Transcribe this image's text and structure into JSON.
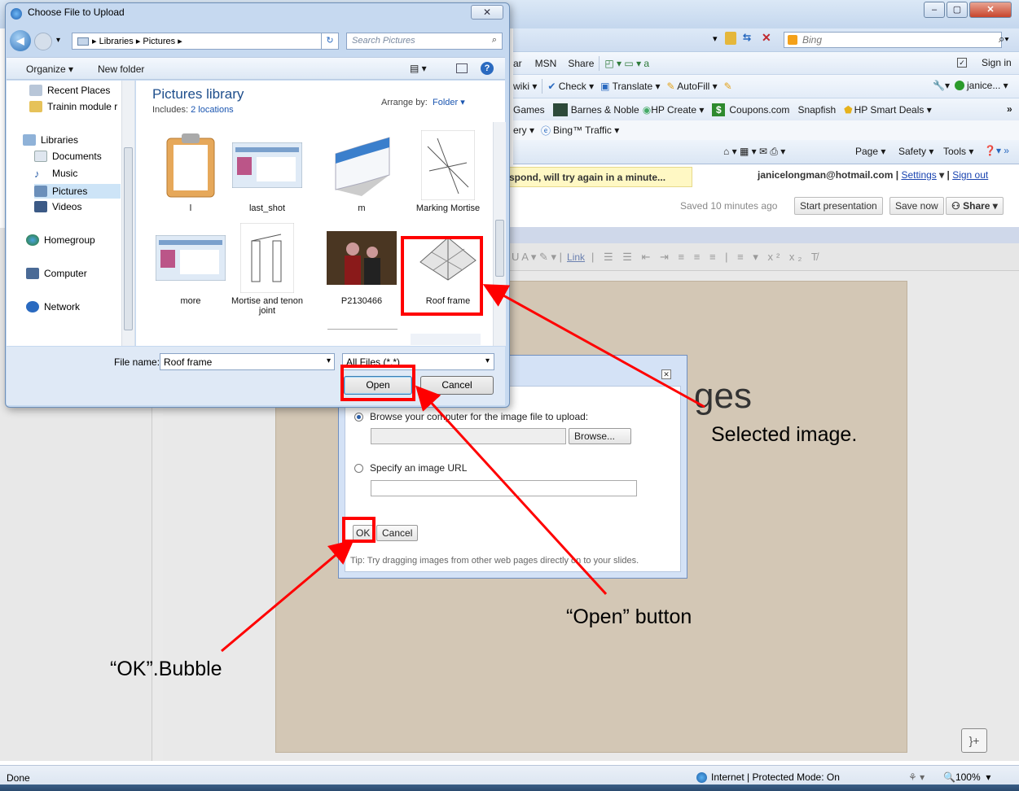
{
  "ie": {
    "bing_placeholder": "Bing",
    "cmd_row1": [
      "ar",
      "MSN",
      "Share"
    ],
    "sign_in": "Sign in",
    "cmd_row2": [
      "wiki ▾",
      "Check ▾",
      "Translate ▾",
      "AutoFill ▾"
    ],
    "user_short": "janice... ▾",
    "favorites": [
      "Games",
      "Barnes & Noble",
      "HP Create",
      "Coupons.com",
      "Snapfish",
      "HP Smart Deals ▾"
    ],
    "tab_items": [
      "ery ▾",
      "Bing™ Traffic ▾"
    ],
    "cmd_row3": [
      "Page ▾",
      "Safety ▾",
      "Tools ▾"
    ],
    "status_done": "Done",
    "status_zone": "Internet | Protected Mode: On",
    "zoom": "100%"
  },
  "docs": {
    "warning": "spond, will try again in a minute...",
    "account": "janicelongman@hotmail.com",
    "settings": "Settings",
    "signout": "Sign out",
    "saved": "Saved 10 minutes ago",
    "start_presentation": "Start presentation",
    "save_now": "Save now",
    "share": "Share",
    "fmt_link": "Link",
    "slide_title": "ges"
  },
  "insert_dialog": {
    "browse_label": "Browse your computer for the image file to upload:",
    "browse_button": "Browse...",
    "url_label": "Specify an image URL",
    "ok": "OK",
    "cancel": "Cancel",
    "tip": "Tip: Try dragging images from other web pages directly on to your slides."
  },
  "file_dialog": {
    "title": "Choose File to Upload",
    "breadcrumb": "▸ Libraries ▸ Pictures ▸",
    "search_placeholder": "Search Pictures",
    "organize": "Organize ▾",
    "new_folder": "New folder",
    "library_title": "Pictures library",
    "includes_label": "Includes:",
    "includes_link": "2 locations",
    "arrange_label": "Arrange by:",
    "arrange_value": "Folder ▾",
    "nav": [
      {
        "label": "Recent Places",
        "icon": "recent-places-icon"
      },
      {
        "label": "Trainin module r",
        "icon": "folder-icon"
      },
      {
        "label": "Libraries",
        "icon": "libraries-icon"
      },
      {
        "label": "Documents",
        "icon": "documents-icon"
      },
      {
        "label": "Music",
        "icon": "music-icon"
      },
      {
        "label": "Pictures",
        "icon": "pictures-icon"
      },
      {
        "label": "Videos",
        "icon": "videos-icon"
      },
      {
        "label": "Homegroup",
        "icon": "homegroup-icon"
      },
      {
        "label": "Computer",
        "icon": "computer-icon"
      },
      {
        "label": "Network",
        "icon": "network-icon"
      }
    ],
    "thumbs": [
      "l",
      "last_shot",
      "m",
      "Marking Mortise",
      "more",
      "Mortise and tenon joint",
      "P2130466",
      "Roof frame"
    ],
    "file_name_label": "File name:",
    "file_name_value": "Roof frame",
    "file_type": "All Files (*.*)",
    "open": "Open",
    "cancel": "Cancel"
  },
  "annotations": {
    "selected_image": "Selected image.",
    "open_button": "“Open” button",
    "ok_bubble": "“OK”.Bubble"
  }
}
